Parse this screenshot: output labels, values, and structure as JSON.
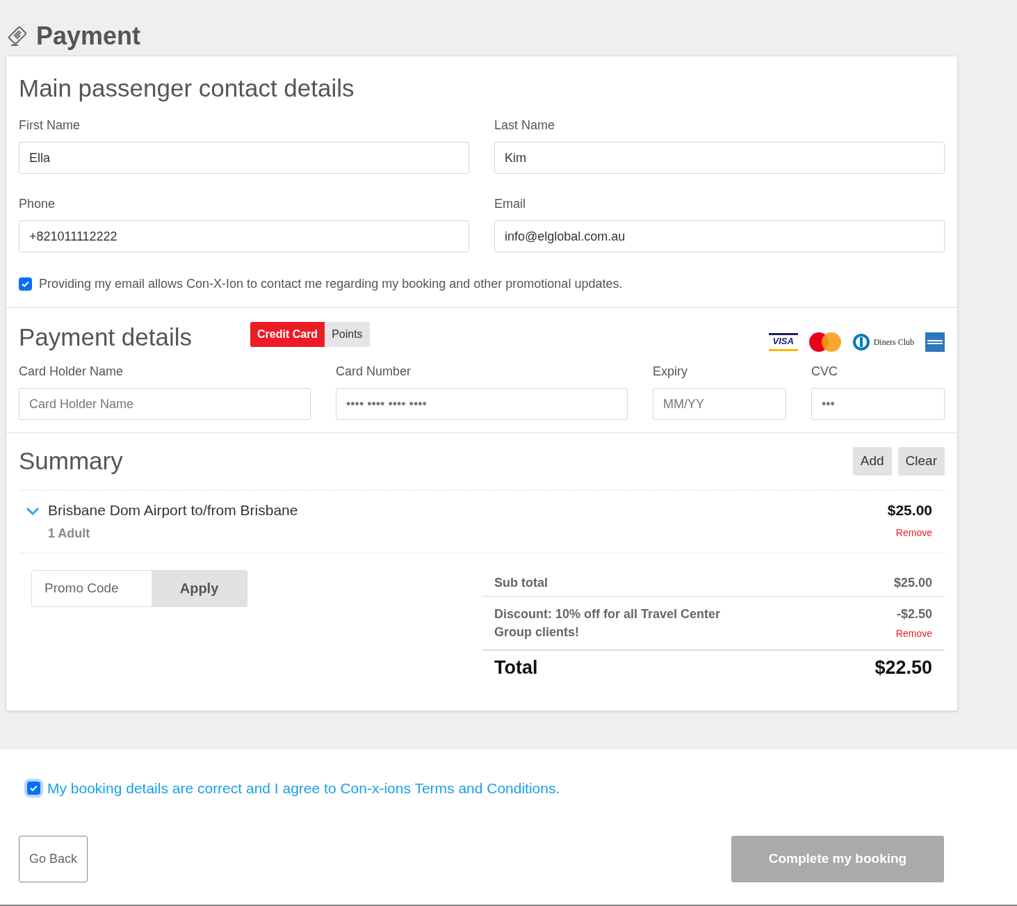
{
  "page_title": "Payment",
  "contact": {
    "heading": "Main passenger contact details",
    "fields": [
      {
        "label": "First Name",
        "value": "Ella"
      },
      {
        "label": "Last Name",
        "value": "Kim"
      },
      {
        "label": "Phone",
        "value": "+821011112222"
      },
      {
        "label": "Email",
        "value": "info@elglobal.com.au"
      }
    ],
    "consent": {
      "checked": true,
      "text": "Providing my email allows Con-X-Ion to contact me regarding my booking and other promotional updates."
    }
  },
  "payment": {
    "heading": "Payment details",
    "methods": [
      {
        "label": "Credit Card",
        "selected": true
      },
      {
        "label": "Points",
        "selected": false
      }
    ],
    "card_logos": [
      {
        "kind": "visa",
        "label": "VISA"
      },
      {
        "kind": "mastercard"
      },
      {
        "kind": "diners",
        "label": "Diners Club"
      },
      {
        "kind": "amex"
      }
    ],
    "fields": [
      {
        "label": "Card Holder Name",
        "placeholder": "Card Holder Name"
      },
      {
        "label": "Card Number",
        "placeholder": "•••• •••• •••• ••••"
      },
      {
        "label": "Expiry",
        "placeholder": "MM/YY"
      },
      {
        "label": "CVC",
        "placeholder": "•••"
      }
    ]
  },
  "summary": {
    "heading": "Summary",
    "buttons": [
      "Add",
      "Clear"
    ],
    "items": [
      {
        "title": "Brisbane Dom Airport to/from Brisbane",
        "detail": "1 Adult",
        "price": "$25.00",
        "remove": "Remove",
        "expanded": true
      }
    ],
    "promo": {
      "placeholder": "Promo Code",
      "button": "Apply"
    },
    "subtotal": {
      "label": "Sub total",
      "value": "$25.00"
    },
    "discount": {
      "label": "Discount: 10% off for all Travel Center Group clients!",
      "value": "-$2.50",
      "remove": "Remove"
    },
    "total": {
      "label": "Total",
      "value": "$22.50"
    }
  },
  "agreement": {
    "checked": true,
    "text": "My booking details are correct and I agree to Con-x-ions Terms and Conditions."
  },
  "buttons": {
    "back": "Go Back",
    "complete": "Complete my booking",
    "complete_disabled": true
  }
}
